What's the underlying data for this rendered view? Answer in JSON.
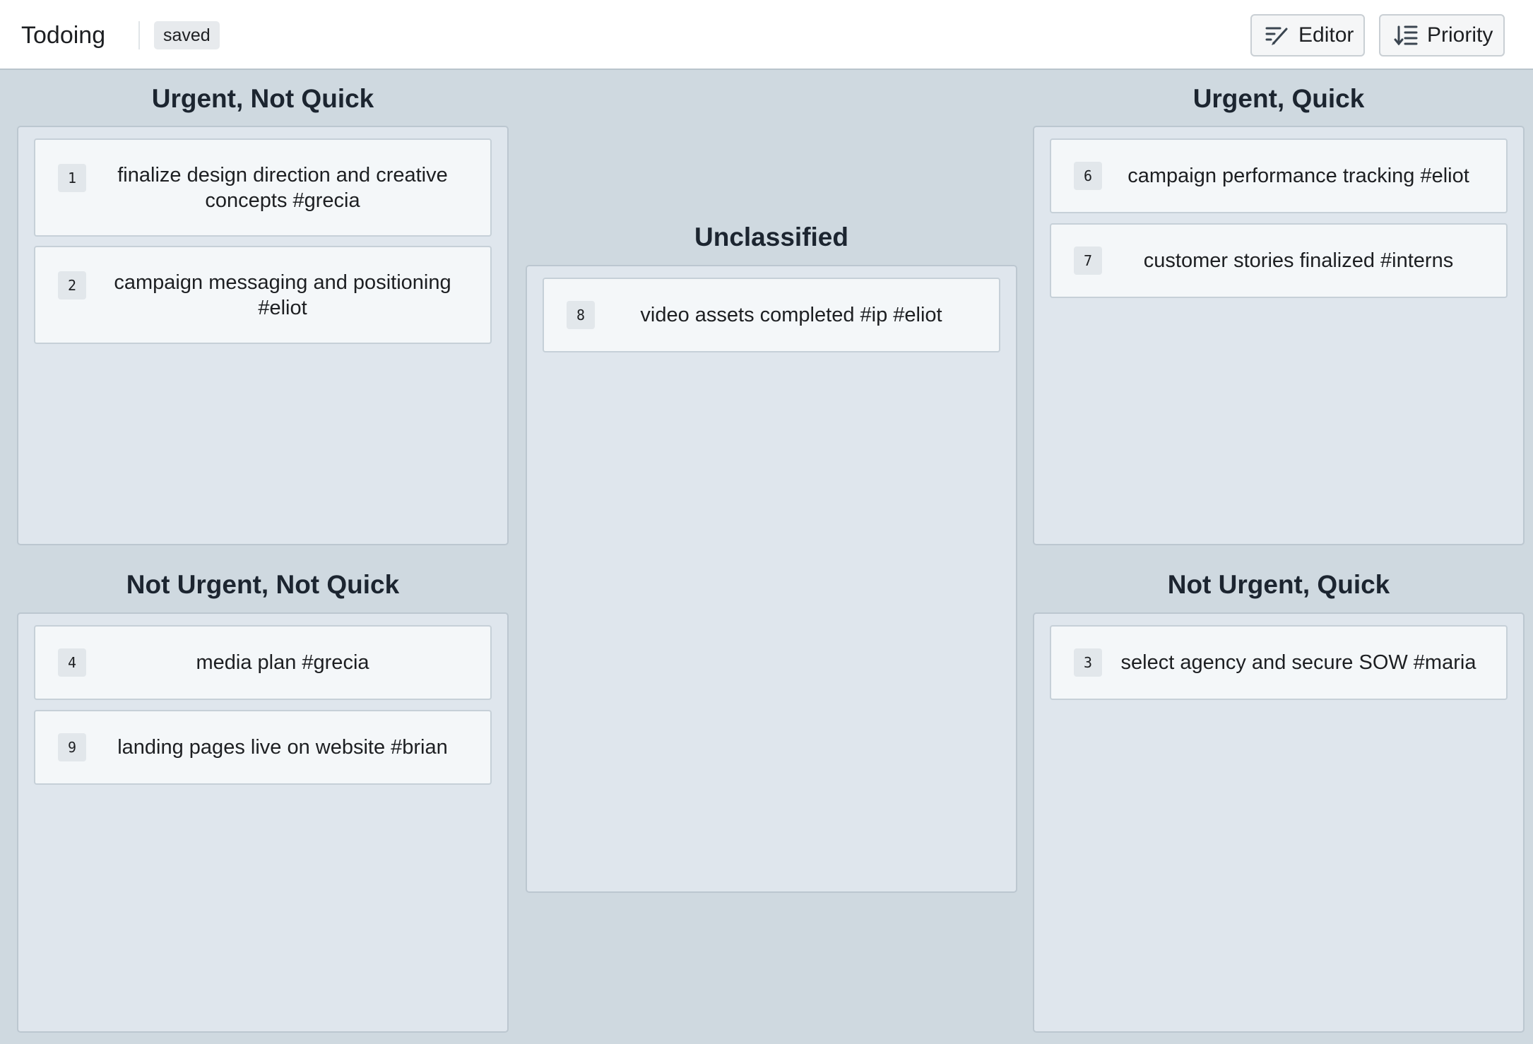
{
  "header": {
    "title": "Todoing",
    "status": "saved",
    "editor_label": "Editor",
    "priority_label": "Priority"
  },
  "quadrants": {
    "urgent_not_quick": {
      "title": "Urgent, Not Quick",
      "cards": [
        {
          "num": "1",
          "text": "finalize design direction and creative concepts #grecia"
        },
        {
          "num": "2",
          "text": "campaign messaging and positioning #eliot"
        }
      ]
    },
    "unclassified": {
      "title": "Unclassified",
      "cards": [
        {
          "num": "8",
          "text": "video assets completed #ip #eliot"
        }
      ]
    },
    "urgent_quick": {
      "title": "Urgent, Quick",
      "cards": [
        {
          "num": "6",
          "text": "campaign performance tracking #eliot"
        },
        {
          "num": "7",
          "text": "customer stories finalized #interns"
        }
      ]
    },
    "not_urgent_not_quick": {
      "title": "Not Urgent, Not Quick",
      "cards": [
        {
          "num": "4",
          "text": "media plan #grecia"
        },
        {
          "num": "9",
          "text": "landing pages live on website #brian"
        }
      ]
    },
    "not_urgent_quick": {
      "title": "Not Urgent, Quick",
      "cards": [
        {
          "num": "3",
          "text": "select agency and secure SOW #maria"
        }
      ]
    }
  }
}
